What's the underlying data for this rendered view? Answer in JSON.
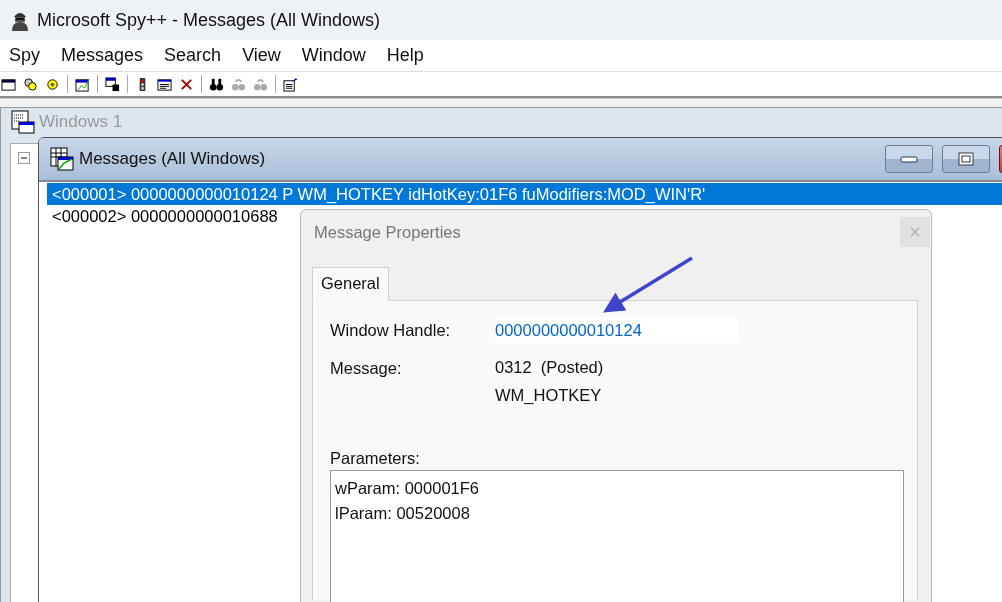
{
  "window": {
    "title": "Microsoft Spy++ - Messages (All Windows)"
  },
  "menu": [
    "Spy",
    "Messages",
    "Search",
    "View",
    "Window",
    "Help"
  ],
  "windows_window": {
    "title": "Windows 1",
    "active": false
  },
  "messages_window": {
    "title": "Messages (All Windows)",
    "active": true,
    "rows": [
      {
        "text": "<000001> 0000000000010124 P WM_HOTKEY idHotKey:01F6 fuModifiers:MOD_WIN'R'",
        "selected": true
      },
      {
        "text": "<000002> 0000000000010688",
        "selected": false
      }
    ]
  },
  "dialog": {
    "title": "Message Properties",
    "tabs": [
      {
        "label": "General",
        "selected": true
      }
    ],
    "fields": [
      {
        "kind": "value-box",
        "label": "Window Handle:",
        "lines": [
          "0000000000010124"
        ]
      },
      {
        "kind": "text",
        "label": "Message:",
        "lines": [
          "0312  (Posted)",
          "WM_HOTKEY"
        ]
      }
    ],
    "parameters": {
      "label": "Parameters:",
      "lines": [
        "wParam: 000001F6",
        "lParam: 00520008"
      ]
    }
  }
}
